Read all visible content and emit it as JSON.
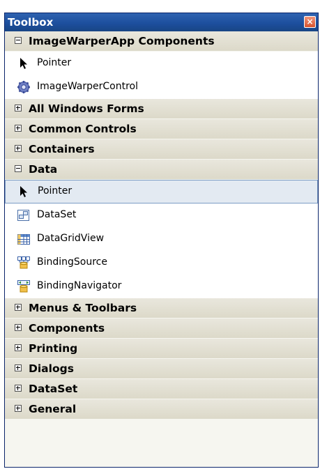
{
  "window": {
    "title": "Toolbox",
    "close_glyph": "×"
  },
  "groups": [
    {
      "id": "imagewarper",
      "label": "ImageWarperApp Components",
      "expanded": true,
      "items": [
        {
          "label": "Pointer",
          "icon": "pointer-icon"
        },
        {
          "label": "ImageWarperControl",
          "icon": "gear-component-icon"
        }
      ]
    },
    {
      "id": "all-windows-forms",
      "label": "All Windows Forms",
      "expanded": false,
      "items": []
    },
    {
      "id": "common-controls",
      "label": "Common Controls",
      "expanded": false,
      "items": []
    },
    {
      "id": "containers",
      "label": "Containers",
      "expanded": false,
      "items": []
    },
    {
      "id": "data",
      "label": "Data",
      "expanded": true,
      "items": [
        {
          "label": "Pointer",
          "icon": "pointer-icon",
          "selected": true
        },
        {
          "label": "DataSet",
          "icon": "dataset-icon"
        },
        {
          "label": "DataGridView",
          "icon": "datagridview-icon"
        },
        {
          "label": "BindingSource",
          "icon": "bindingsource-icon"
        },
        {
          "label": "BindingNavigator",
          "icon": "bindingnavigator-icon"
        }
      ]
    },
    {
      "id": "menus-toolbars",
      "label": "Menus & Toolbars",
      "expanded": false,
      "items": []
    },
    {
      "id": "components",
      "label": "Components",
      "expanded": false,
      "items": []
    },
    {
      "id": "printing",
      "label": "Printing",
      "expanded": false,
      "items": []
    },
    {
      "id": "dialogs",
      "label": "Dialogs",
      "expanded": false,
      "items": []
    },
    {
      "id": "dataset",
      "label": "DataSet",
      "expanded": false,
      "items": []
    },
    {
      "id": "general",
      "label": "General",
      "expanded": false,
      "items": []
    }
  ]
}
